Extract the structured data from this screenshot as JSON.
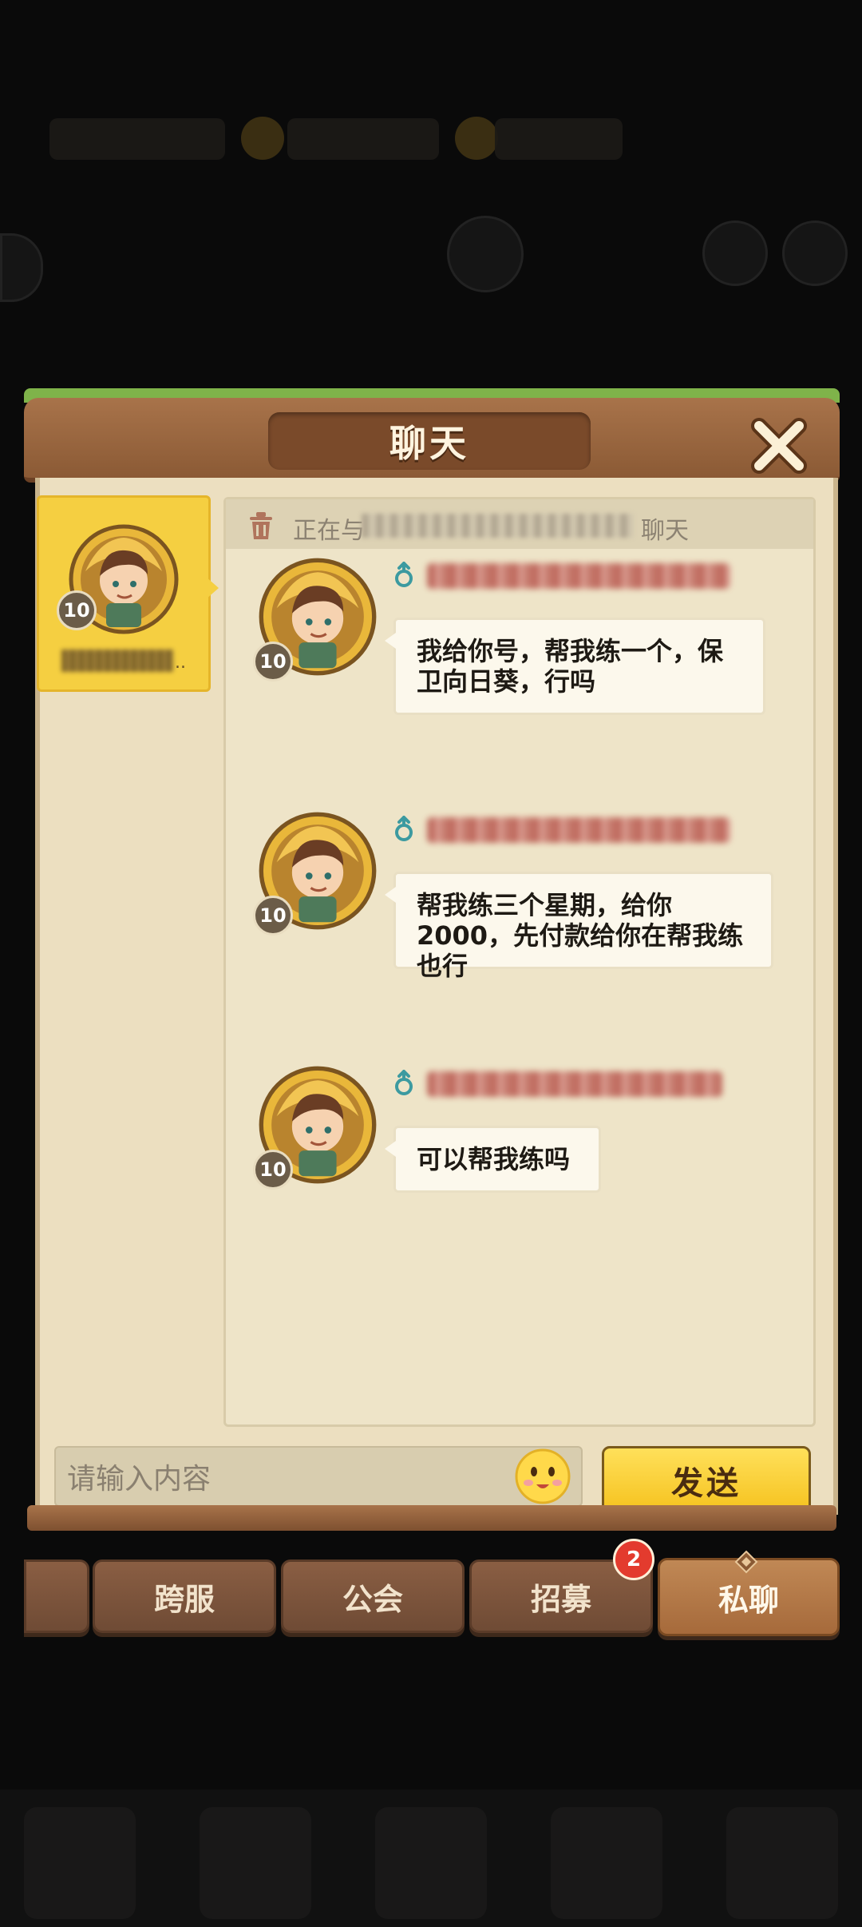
{
  "dialog": {
    "title": "聊天",
    "close_icon": "close-x-icon"
  },
  "contacts": [
    {
      "level": "10",
      "avatar_icon": "farmer-avatar-icon",
      "name_suffix": ".."
    }
  ],
  "chat": {
    "header_prefix": "正在与",
    "header_suffix": "聊天",
    "messages": [
      {
        "level": "10",
        "avatar_icon": "farmer-avatar-icon",
        "gender_icon": "male-icon",
        "text": "我给你号，帮我练一个，保卫向日葵，行吗"
      },
      {
        "level": "10",
        "avatar_icon": "farmer-avatar-icon",
        "gender_icon": "male-icon",
        "text": "帮我练三个星期，给你2000，先付款给你在帮我练也行"
      },
      {
        "level": "10",
        "avatar_icon": "farmer-avatar-icon",
        "gender_icon": "male-icon",
        "text": "可以帮我练吗"
      }
    ]
  },
  "input": {
    "placeholder": "请输入内容",
    "emoji_icon": "smiley-emoji-icon",
    "send_label": "发送"
  },
  "tabs": [
    {
      "label": "跨服",
      "active": false
    },
    {
      "label": "公会",
      "active": false
    },
    {
      "label": "招募",
      "active": false,
      "badge": "2"
    },
    {
      "label": "私聊",
      "active": true
    }
  ],
  "colors": {
    "wood": "#8b5a35",
    "panel": "#ecdfc0",
    "send_button": "#f5c21e",
    "contact_selected": "#f5cf41",
    "badge": "#e33b2e"
  }
}
